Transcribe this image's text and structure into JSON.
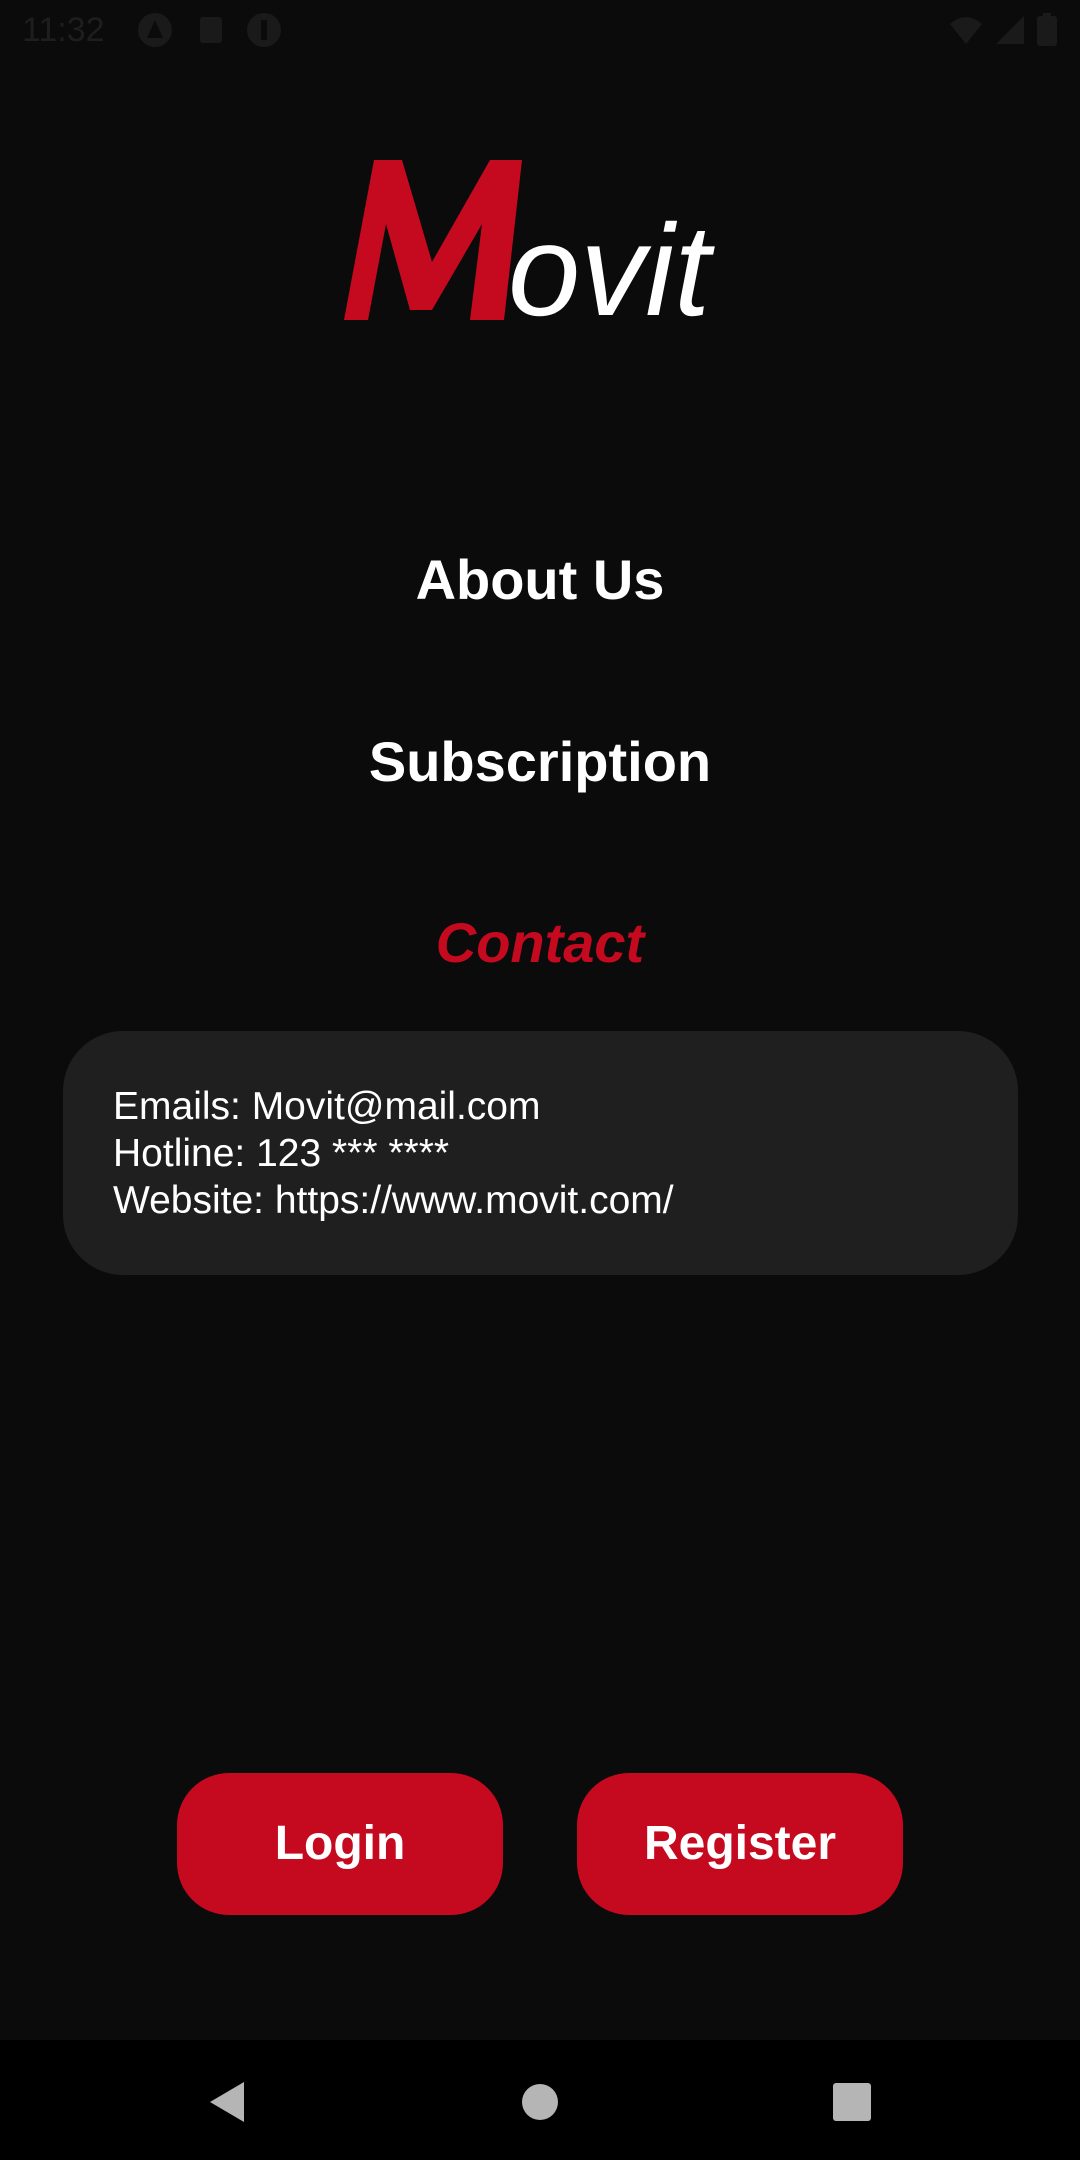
{
  "status_bar": {
    "time": "11:32"
  },
  "logo": {
    "first_letter": "M",
    "rest": "ovit",
    "accent_color": "#c50a20",
    "text_color": "#ffffff"
  },
  "menu": {
    "about": "About Us",
    "subscription": "Subscription",
    "contact": "Contact"
  },
  "contact_card": {
    "lines": [
      "Emails: Movit@mail.com",
      "Hotline: 123 *** ****",
      "Website: https://www.movit.com/"
    ]
  },
  "buttons": {
    "login": "Login",
    "register": "Register"
  },
  "icons": {
    "status_left": [
      "notification-icon",
      "sim-icon",
      "app-icon"
    ],
    "status_right": [
      "wifi-icon",
      "signal-icon",
      "battery-icon"
    ],
    "nav": [
      "back-icon",
      "home-icon",
      "recents-icon"
    ]
  },
  "colors": {
    "background": "#0b0b0b",
    "card": "#1f1f1f",
    "accent": "#c50a20"
  }
}
